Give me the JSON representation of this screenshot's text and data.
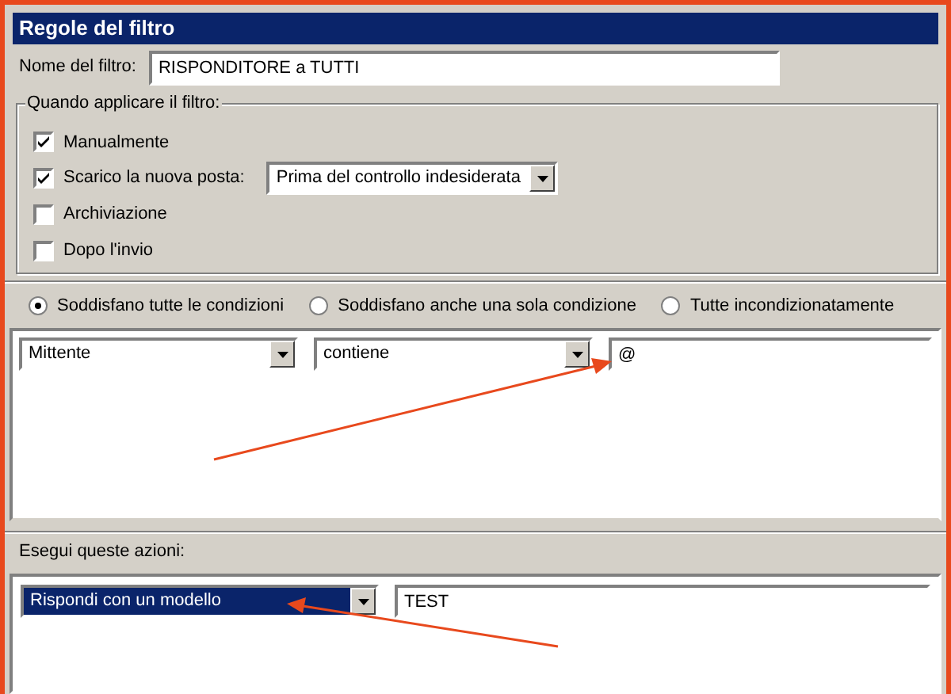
{
  "window": {
    "title": "Regole del filtro"
  },
  "filter_name": {
    "label": "Nome del filtro:",
    "value": "RISPONDITORE a TUTTI"
  },
  "when_group": {
    "title": "Quando applicare il filtro:",
    "options": [
      {
        "label": "Manualmente",
        "checked": true
      },
      {
        "label": "Scarico la nuova posta:",
        "checked": true,
        "dropdown": "Prima del controllo indesiderata"
      },
      {
        "label": "Archiviazione",
        "checked": false
      },
      {
        "label": "Dopo l'invio",
        "checked": false
      }
    ]
  },
  "match_mode": [
    {
      "label": "Soddisfano tutte le condizioni",
      "selected": true
    },
    {
      "label": "Soddisfano anche una sola condizione",
      "selected": false
    },
    {
      "label": "Tutte incondizionatamente",
      "selected": false
    }
  ],
  "conditions": [
    {
      "field": "Mittente",
      "operator": "contiene",
      "value": "@"
    }
  ],
  "actions_label": "Esegui queste azioni:",
  "actions": [
    {
      "action": "Rispondi con un modello",
      "selected": true,
      "value": "TEST"
    }
  ]
}
